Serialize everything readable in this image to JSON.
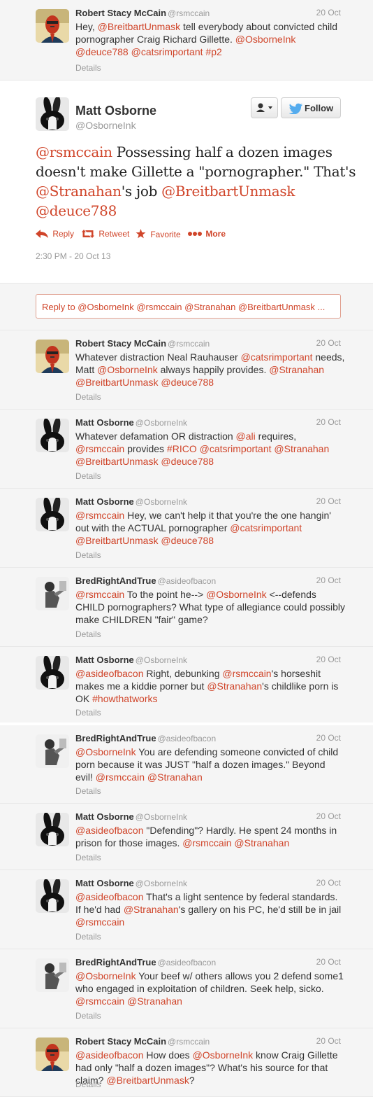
{
  "tweets_above": [
    {
      "name": "Robert Stacy McCain",
      "handle": "@rsmccain",
      "date": "20 Oct",
      "avatar": "face-avatar",
      "body_html": "Hey, <span class=\"link\">@BreitbartUnmask</span> tell everybody about convicted child pornographer Craig Richard Gillette. <span class=\"link\">@OsborneInk</span> <span class=\"link\">@deuce788</span> <span class=\"link\">@catsrimportant</span> <span class=\"link\">#p2</span>",
      "details": "Details"
    }
  ],
  "main_tweet": {
    "name": "Matt Osborne",
    "handle": "@OsborneInk",
    "follow_label": "Follow",
    "text_html": "<span class=\"link\">@rsmccain</span> Possessing half a dozen images doesn't make Gillette a \"pornographer.\" That's <span class=\"link\">@Stranahan</span>'s job <span class=\"link\">@BreitbartUnmask</span> <span class=\"link\">@deuce788</span>",
    "actions": {
      "reply": "Reply",
      "retweet": "Retweet",
      "favorite": "Favorite",
      "more": "More"
    },
    "timestamp": "2:30 PM - 20 Oct 13",
    "reply_placeholder": "Reply to @OsborneInk @rsmccain @Stranahan @BreitbartUnmask ..."
  },
  "replies": [
    {
      "name": "Robert Stacy McCain",
      "handle": "@rsmccain",
      "date": "20 Oct",
      "avatar": "face-avatar",
      "body_html": "Whatever distraction Neal Rauhauser <span class=\"link\">@catsrimportant</span> needs, Matt <span class=\"link\">@OsborneInk</span> always happily provides. <span class=\"link\">@Stranahan</span> <span class=\"link\">@BreitbartUnmask</span> <span class=\"link\">@deuce788</span>",
      "details": "Details"
    },
    {
      "name": "Matt Osborne",
      "handle": "@OsborneInk",
      "date": "20 Oct",
      "avatar": "rabbit-avatar",
      "body_html": "Whatever defamation OR distraction <span class=\"link\">@ali</span> requires, <span class=\"link\">@rsmccain</span> provides <span class=\"link\">#RICO</span> <span class=\"link\">@catsrimportant</span> <span class=\"link\">@Stranahan</span> <span class=\"link\">@BreitbartUnmask</span> <span class=\"link\">@deuce788</span>",
      "details": "Details"
    },
    {
      "name": "Matt Osborne",
      "handle": "@OsborneInk",
      "date": "20 Oct",
      "avatar": "rabbit-avatar",
      "body_html": "<span class=\"link\">@rsmccain</span> Hey, we can't help it that you're the one hangin' out with the ACTUAL pornographer <span class=\"link\">@catsrimportant</span> <span class=\"link\">@BreitbartUnmask</span> <span class=\"link\">@deuce788</span>",
      "details": "Details"
    },
    {
      "name": "BredRightAndTrue",
      "handle": "@asideofbacon",
      "date": "20 Oct",
      "avatar": "person-avatar",
      "body_html": "<span class=\"link\">@rsmccain</span> To the point he--&gt; <span class=\"link\">@OsborneInk</span> &lt;--defends CHILD pornographers? What type of allegiance could possibly make CHILDREN \"fair\" game?",
      "details": "Details"
    },
    {
      "name": "Matt Osborne",
      "handle": "@OsborneInk",
      "date": "20 Oct",
      "avatar": "rabbit-avatar",
      "body_html": "<span class=\"link\">@asideofbacon</span> Right, debunking <span class=\"link\">@rsmccain</span>'s horseshit makes me a kiddie porner but <span class=\"link\">@Stranahan</span>'s childlike porn is OK <span class=\"link\">#howthatworks</span>",
      "details": "Details"
    },
    {
      "name": "BredRightAndTrue",
      "handle": "@asideofbacon",
      "date": "20 Oct",
      "avatar": "person-avatar",
      "body_html": "<span class=\"link\">@OsborneInk</span> You are defending someone convicted of child porn because it was JUST \"half a dozen images.\" Beyond evil! <span class=\"link\">@rsmccain</span> <span class=\"link\">@Stranahan</span>",
      "details": "Details"
    },
    {
      "name": "Matt Osborne",
      "handle": "@OsborneInk",
      "date": "20 Oct",
      "avatar": "rabbit-avatar",
      "body_html": "<span class=\"link\">@asideofbacon</span> \"Defending\"? Hardly. He spent 24 months in prison for those images. <span class=\"link\">@rsmccain</span> <span class=\"link\">@Stranahan</span>",
      "details": "Details"
    },
    {
      "name": "Matt Osborne",
      "handle": "@OsborneInk",
      "date": "20 Oct",
      "avatar": "rabbit-avatar",
      "body_html": "<span class=\"link\">@asideofbacon</span> That's a light sentence by federal standards. If he'd had <span class=\"link\">@Stranahan</span>'s gallery on his PC, he'd still be in jail <span class=\"link\">@rsmccain</span>",
      "details": "Details"
    },
    {
      "name": "BredRightAndTrue",
      "handle": "@asideofbacon",
      "date": "20 Oct",
      "avatar": "person-avatar",
      "body_html": "<span class=\"link\">@OsborneInk</span> Your beef w/ others allows you 2 defend some1 who engaged in exploitation of children. Seek help, sicko. <span class=\"link\">@rsmccain</span> <span class=\"link\">@Stranahan</span>",
      "details": "Details"
    },
    {
      "name": "Robert Stacy McCain",
      "handle": "@rsmccain",
      "date": "20 Oct",
      "avatar": "face-avatar",
      "body_html": "<span class=\"link\">@asideofbacon</span> How does <span class=\"link\">@OsborneInk</span> know Craig Gillette had only \"half a dozen images\"? What's his source for that claim? <span class=\"link\">@BreitbartUnmask</span>?",
      "details": "Details"
    }
  ],
  "colors": {
    "link": "#d0452a",
    "follow_bird": "#55acee",
    "muted": "#999999"
  }
}
